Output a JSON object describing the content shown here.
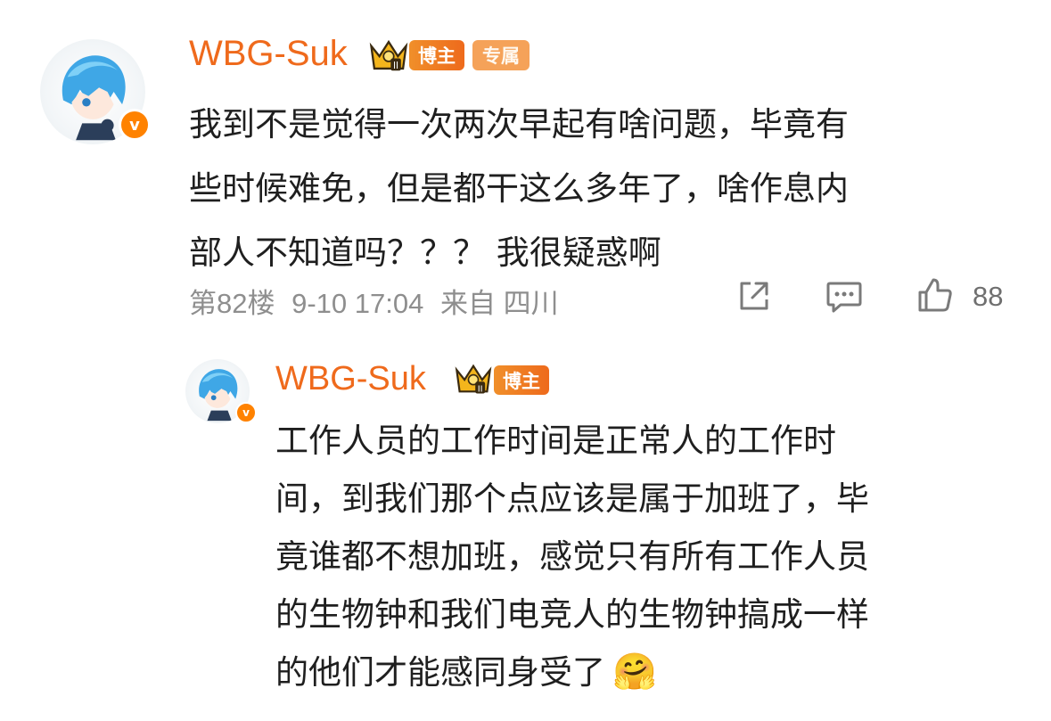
{
  "comment": {
    "username": "WBG-Suk",
    "host_tag": "博主",
    "exclusive_tag": "专属",
    "verified_icon": "v-verified-icon",
    "text": "我到不是觉得一次两次早起有啥问题，毕竟有\n些时候难免，但是都干这么多年了，啥作息内\n部人不知道吗？？？ 我很疑惑啊",
    "floor": "第82楼",
    "time": "9-10 17:04",
    "source": "来自 四川",
    "like_count": "88"
  },
  "reply": {
    "username": "WBG-Suk",
    "host_tag": "博主",
    "text": "工作人员的工作时间是正常人的工作时\n间，到我们那个点应该是属于加班了，毕\n竟谁都不想加班，感觉只有所有工作人员\n的生物钟和我们电竞人的生物钟搞成一样\n的他们才能感同身受了",
    "emoji": "🤗"
  },
  "colors": {
    "username": "#ef6a1c",
    "verified": "#ff8200",
    "meta": "#8e8e8e"
  }
}
